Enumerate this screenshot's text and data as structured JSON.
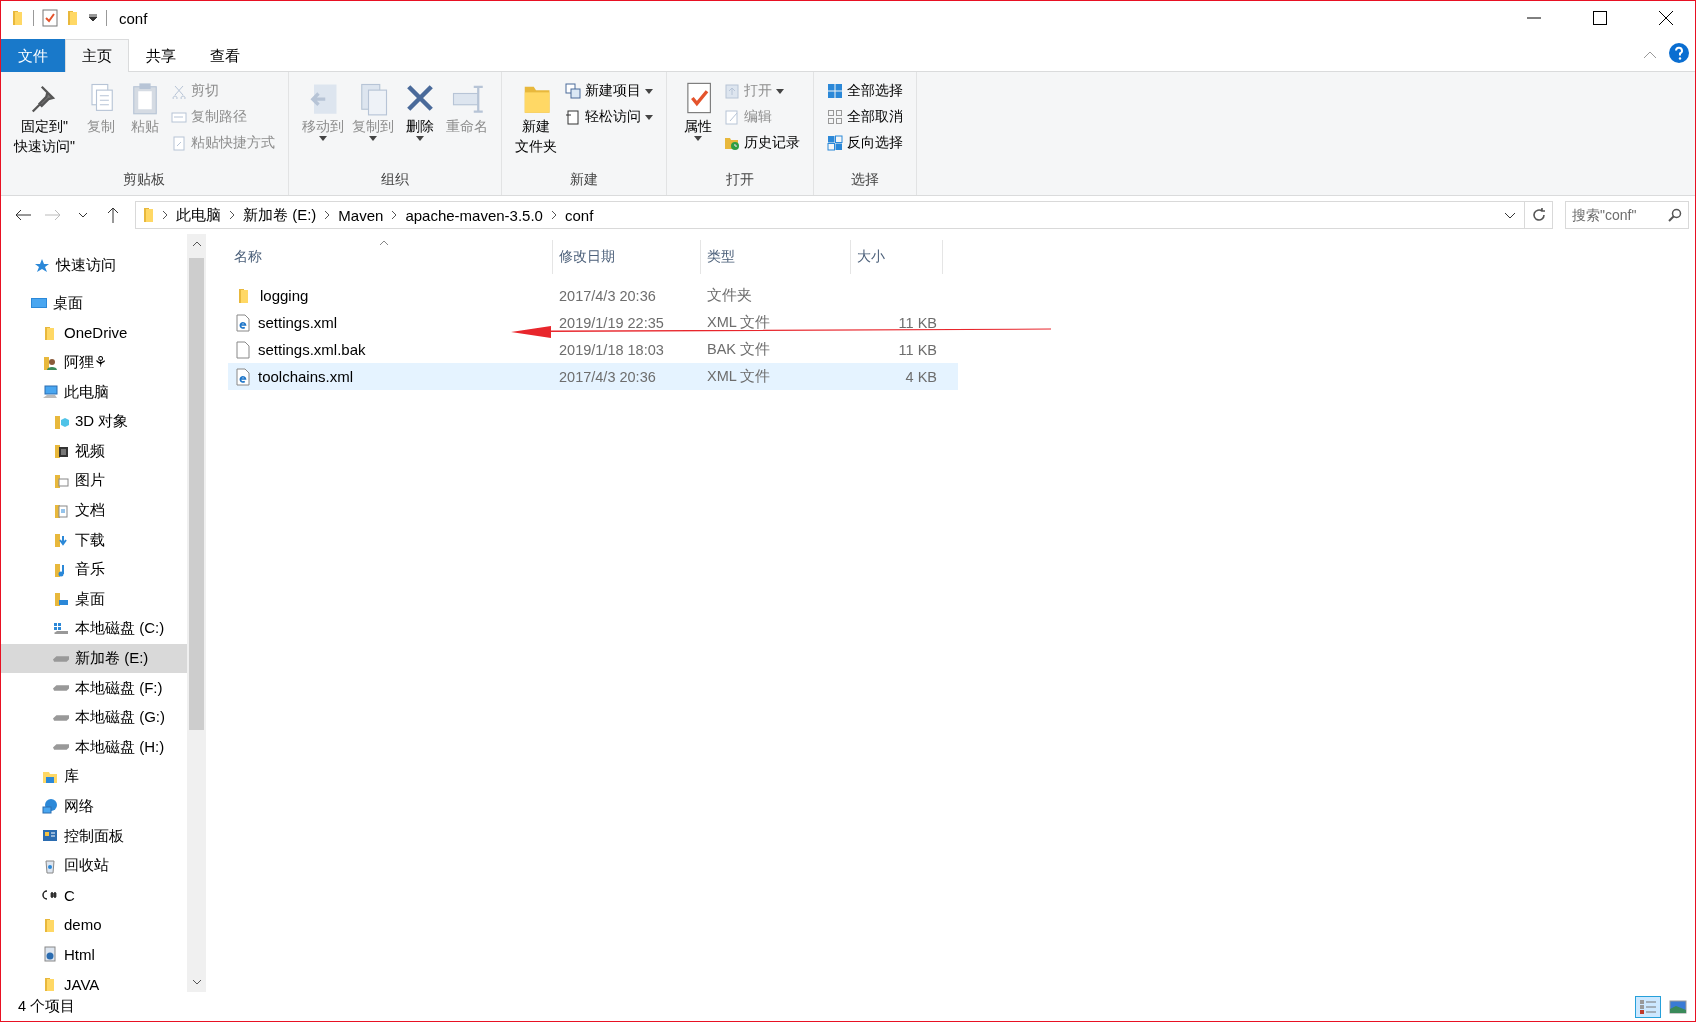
{
  "window": {
    "title": "conf"
  },
  "ribbon_tabs": [
    {
      "label": "文件",
      "kind": "file",
      "selected": false
    },
    {
      "label": "主页",
      "kind": "tab",
      "selected": true
    },
    {
      "label": "共享",
      "kind": "tab",
      "selected": false
    },
    {
      "label": "查看",
      "kind": "tab",
      "selected": false
    }
  ],
  "ribbon_groups": [
    {
      "label": "剪贴板",
      "items": [
        {
          "kind": "large",
          "lines": [
            "固定到\"",
            "快速访问\""
          ],
          "disabled": false,
          "dropdown": false
        },
        {
          "kind": "large",
          "label": "复制",
          "disabled": true,
          "dropdown": false
        },
        {
          "kind": "large",
          "label": "粘贴",
          "disabled": true,
          "dropdown": false
        },
        {
          "kind": "small",
          "label": "剪切",
          "disabled": true,
          "dropdown": false
        },
        {
          "kind": "small",
          "label": "复制路径",
          "disabled": true,
          "dropdown": false
        },
        {
          "kind": "small",
          "label": "粘贴快捷方式",
          "disabled": true,
          "dropdown": false
        }
      ]
    },
    {
      "label": "组织",
      "items": [
        {
          "kind": "large",
          "label": "移动到",
          "disabled": true,
          "dropdown": true
        },
        {
          "kind": "large",
          "label": "复制到",
          "disabled": true,
          "dropdown": true
        },
        {
          "kind": "large",
          "label": "删除",
          "disabled": false,
          "dropdown": true
        },
        {
          "kind": "large",
          "label": "重命名",
          "disabled": true,
          "dropdown": false
        }
      ]
    },
    {
      "label": "新建",
      "items": [
        {
          "kind": "large",
          "lines": [
            "新建",
            "文件夹"
          ],
          "disabled": false,
          "dropdown": false
        },
        {
          "kind": "small",
          "label": "新建项目",
          "disabled": false,
          "dropdown": true
        },
        {
          "kind": "small",
          "label": "轻松访问",
          "disabled": false,
          "dropdown": true
        }
      ]
    },
    {
      "label": "打开",
      "items": [
        {
          "kind": "large",
          "label": "属性",
          "disabled": false,
          "dropdown": true
        },
        {
          "kind": "small",
          "label": "打开",
          "disabled": true,
          "dropdown": true
        },
        {
          "kind": "small",
          "label": "编辑",
          "disabled": true,
          "dropdown": false
        },
        {
          "kind": "small",
          "label": "历史记录",
          "disabled": false,
          "dropdown": false
        }
      ]
    },
    {
      "label": "选择",
      "items": [
        {
          "kind": "small",
          "label": "全部选择",
          "disabled": false,
          "dropdown": false
        },
        {
          "kind": "small",
          "label": "全部取消",
          "disabled": false,
          "dropdown": false
        },
        {
          "kind": "small",
          "label": "反向选择",
          "disabled": false,
          "dropdown": false
        }
      ]
    }
  ],
  "address": {
    "crumbs": [
      "此电脑",
      "新加卷 (E:)",
      "Maven",
      "apache-maven-3.5.0",
      "conf"
    ]
  },
  "search": {
    "placeholder": "搜索\"conf\""
  },
  "columns": [
    {
      "label": "名称",
      "sorted": true
    },
    {
      "label": "修改日期",
      "sorted": false
    },
    {
      "label": "类型",
      "sorted": false
    },
    {
      "label": "大小",
      "sorted": false
    }
  ],
  "files": [
    {
      "kind": "folder",
      "name": "logging",
      "date": "2017/4/3 20:36",
      "type": "文件夹",
      "selected": false
    },
    {
      "kind": "xml",
      "name": "settings.xml",
      "date": "2019/1/19 22:35",
      "type": "XML 文件",
      "size": "11 KB",
      "selected": false
    },
    {
      "kind": "file",
      "name": "settings.xml.bak",
      "date": "2019/1/18 18:03",
      "type": "BAK 文件",
      "size": "11 KB",
      "selected": false
    },
    {
      "kind": "xml",
      "name": "toolchains.xml",
      "date": "2017/4/3 20:36",
      "type": "XML 文件",
      "size": "4 KB",
      "selected": true
    }
  ],
  "nav": [
    {
      "kind": "star",
      "label": "快速访问",
      "selected": false
    },
    {
      "kind": "desktop",
      "label": "桌面",
      "selected": false,
      "children": [
        {
          "kind": "folder",
          "label": "OneDrive",
          "selected": false
        },
        {
          "kind": "user",
          "label": "阿狸⚘",
          "selected": false
        },
        {
          "kind": "pc",
          "label": "此电脑",
          "selected": false,
          "children": [
            {
              "kind": "cube",
              "label": "3D 对象",
              "selected": false
            },
            {
              "kind": "video",
              "label": "视频",
              "selected": false
            },
            {
              "kind": "picture",
              "label": "图片",
              "selected": false
            },
            {
              "kind": "doc",
              "label": "文档",
              "selected": false
            },
            {
              "kind": "download",
              "label": "下载",
              "selected": false
            },
            {
              "kind": "music",
              "label": "音乐",
              "selected": false
            },
            {
              "kind": "deskfolder",
              "label": "桌面",
              "selected": false
            },
            {
              "kind": "windrive",
              "label": "本地磁盘 (C:)",
              "selected": false
            },
            {
              "kind": "drive",
              "label": "新加卷 (E:)",
              "selected": true
            },
            {
              "kind": "drive",
              "label": "本地磁盘 (F:)",
              "selected": false
            },
            {
              "kind": "drive",
              "label": "本地磁盘 (G:)",
              "selected": false
            },
            {
              "kind": "drive",
              "label": "本地磁盘 (H:)",
              "selected": false
            }
          ]
        },
        {
          "kind": "library",
          "label": "库",
          "selected": false
        },
        {
          "kind": "network",
          "label": "网络",
          "selected": false
        },
        {
          "kind": "control",
          "label": "控制面板",
          "selected": false
        },
        {
          "kind": "recycle",
          "label": "回收站",
          "selected": false
        },
        {
          "kind": "csharp",
          "label": "C",
          "selected": false
        },
        {
          "kind": "folder",
          "label": "demo",
          "selected": false
        },
        {
          "kind": "html",
          "label": "Html",
          "selected": false
        },
        {
          "kind": "folder",
          "label": "JAVA",
          "selected": false
        }
      ]
    }
  ],
  "status": {
    "count": "4 个项目"
  },
  "view_buttons": [
    {
      "kind": "details",
      "selected": true
    },
    {
      "kind": "thumbnails",
      "selected": false
    }
  ]
}
